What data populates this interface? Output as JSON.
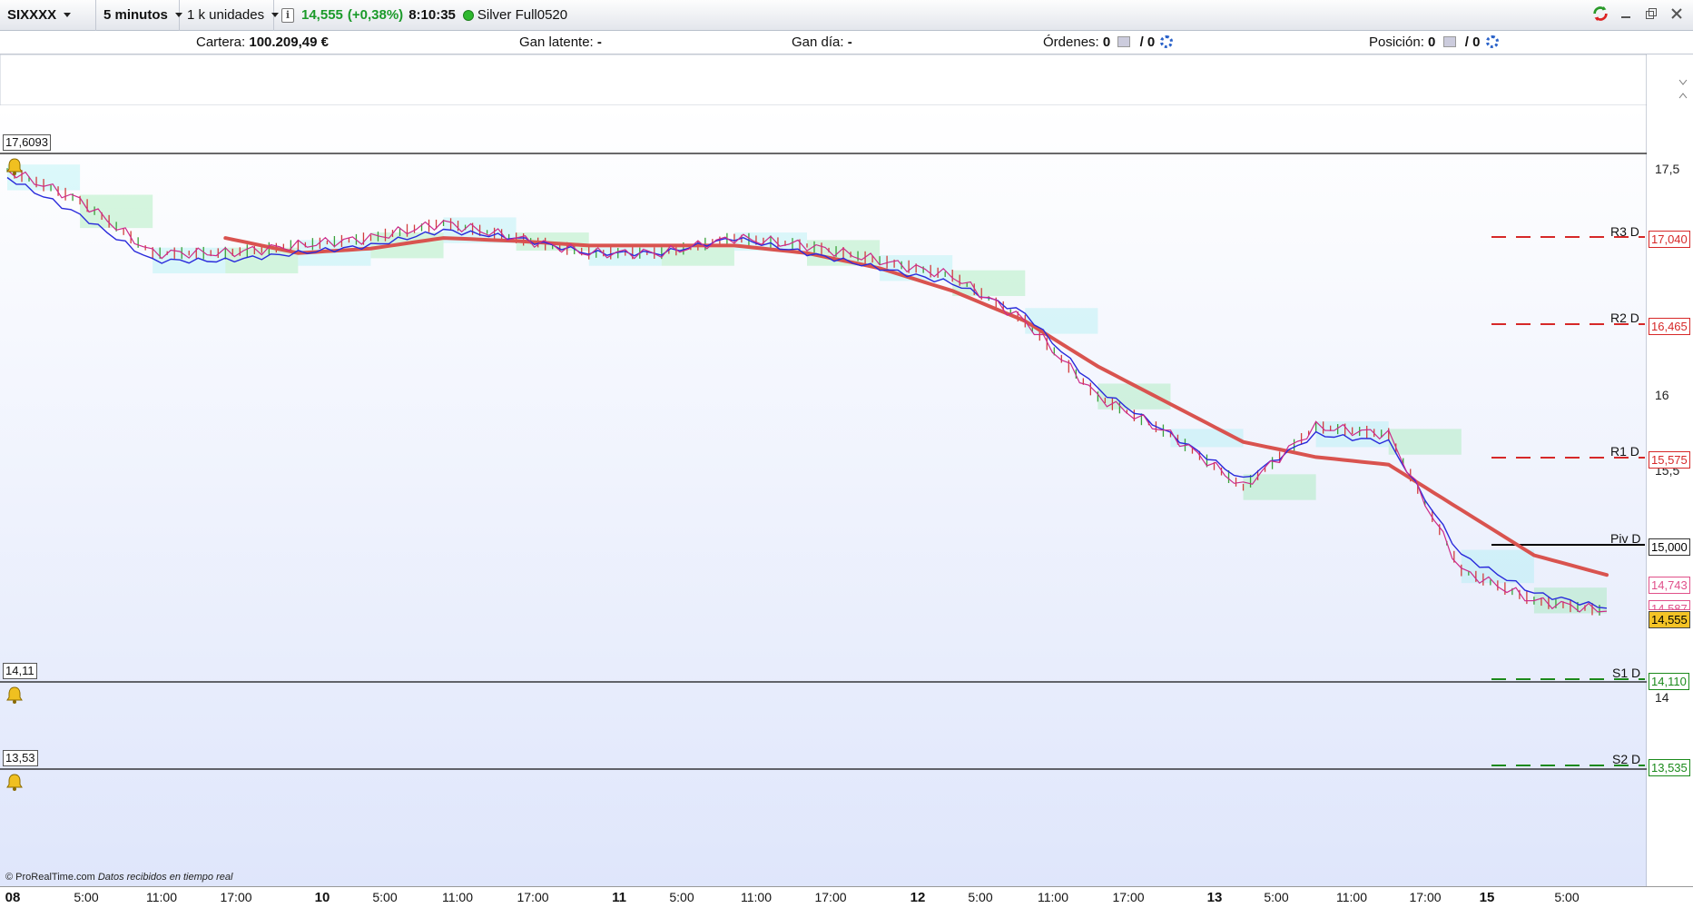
{
  "toolbar": {
    "instrument": "SIXXXX",
    "timeframe": "5 minutos",
    "quantity": "1 k unidades",
    "info": "i",
    "last_price": "14,555",
    "change": "(+0,38%)",
    "time": "8:10:35",
    "account": "Silver Full0520"
  },
  "account_bar": {
    "cartera_label": "Cartera:",
    "cartera_value": "100.209,49 €",
    "gan_latente_label": "Gan latente:",
    "gan_latente_value": "-",
    "gan_dia_label": "Gan día:",
    "gan_dia_value": "-",
    "ordenes_label": "Órdenes:",
    "ordenes_value": "0",
    "ordenes_value2": "/ 0",
    "posicion_label": "Posición:",
    "posicion_value": "0",
    "posicion_value2": "/ 0"
  },
  "chart": {
    "price_max_label": "17,6093",
    "alert_low_1": "14,11",
    "alert_low_2": "13,53",
    "y_ticks": [
      "17,5",
      "16",
      "15,5",
      "14"
    ],
    "pivots": [
      {
        "name": "R3 D",
        "value": "17,040",
        "color": "#d62828"
      },
      {
        "name": "R2 D",
        "value": "16,465",
        "color": "#d62828"
      },
      {
        "name": "R1 D",
        "value": "15,575",
        "color": "#d62828"
      },
      {
        "name": "Piv D",
        "value": "15,000",
        "color": "#000000"
      },
      {
        "name": "S1 D",
        "value": "14,110",
        "color": "#1b8a1b"
      },
      {
        "name": "S2 D",
        "value": "13,535",
        "color": "#1b8a1b"
      }
    ],
    "price_tags": [
      {
        "value": "14,743",
        "color": "#e0508a"
      },
      {
        "value": "14,587",
        "color": "#e0508a"
      },
      {
        "value": "14,555",
        "color": "#000000"
      }
    ],
    "footer": "© ProRealTime.com",
    "footer_italic": "Datos recibidos en tiempo real",
    "colors": {
      "sma": "#d9534f",
      "fast": "#2a2adb",
      "price": "#cc2a8a",
      "cloud_green": "#8de8a4",
      "cloud_cyan": "#9eeef2"
    }
  },
  "chart_data": {
    "type": "line",
    "x": [
      "08 0:00",
      "08 5:00",
      "08 11:00",
      "08 17:00",
      "10 0:00",
      "10 5:00",
      "10 11:00",
      "10 17:00",
      "11 0:00",
      "11 5:00",
      "11 11:00",
      "11 17:00",
      "12 0:00",
      "12 5:00",
      "12 11:00",
      "12 17:00",
      "13 0:00",
      "13 5:00",
      "13 11:00",
      "13 17:00",
      "15 0:00",
      "15 5:00",
      "15 8:10"
    ],
    "series": [
      {
        "values": [
          17.5,
          17.3,
          16.95,
          16.95,
          17.0,
          17.05,
          17.15,
          17.05,
          16.95,
          16.95,
          17.05,
          17.0,
          16.9,
          16.8,
          16.5,
          16.0,
          15.75,
          15.4,
          15.8,
          15.75,
          14.85,
          14.65,
          14.58
        ]
      },
      {
        "values": [
          17.45,
          17.2,
          16.9,
          16.9,
          16.95,
          17.0,
          17.1,
          17.05,
          16.95,
          16.95,
          17.05,
          16.95,
          16.85,
          16.75,
          16.55,
          16.05,
          15.75,
          15.45,
          15.75,
          15.7,
          14.95,
          14.7,
          14.6
        ]
      },
      {
        "values": [
          null,
          null,
          null,
          17.05,
          16.95,
          16.98,
          17.05,
          17.03,
          17.0,
          17.0,
          17.0,
          16.95,
          16.85,
          16.7,
          16.5,
          16.2,
          15.95,
          15.7,
          15.6,
          15.55,
          15.25,
          14.95,
          14.82
        ]
      }
    ],
    "ylim": [
      13.3,
      17.7
    ]
  },
  "time_axis": {
    "labels": [
      {
        "text": "08",
        "day": true
      },
      {
        "text": "5:00"
      },
      {
        "text": "11:00"
      },
      {
        "text": "17:00"
      },
      {
        "text": "10",
        "day": true
      },
      {
        "text": "5:00"
      },
      {
        "text": "11:00"
      },
      {
        "text": "17:00"
      },
      {
        "text": "11",
        "day": true
      },
      {
        "text": "5:00"
      },
      {
        "text": "11:00"
      },
      {
        "text": "17:00"
      },
      {
        "text": "12",
        "day": true
      },
      {
        "text": "5:00"
      },
      {
        "text": "11:00"
      },
      {
        "text": "17:00"
      },
      {
        "text": "13",
        "day": true
      },
      {
        "text": "5:00"
      },
      {
        "text": "11:00"
      },
      {
        "text": "17:00"
      },
      {
        "text": "15",
        "day": true
      },
      {
        "text": "5:00"
      }
    ]
  }
}
